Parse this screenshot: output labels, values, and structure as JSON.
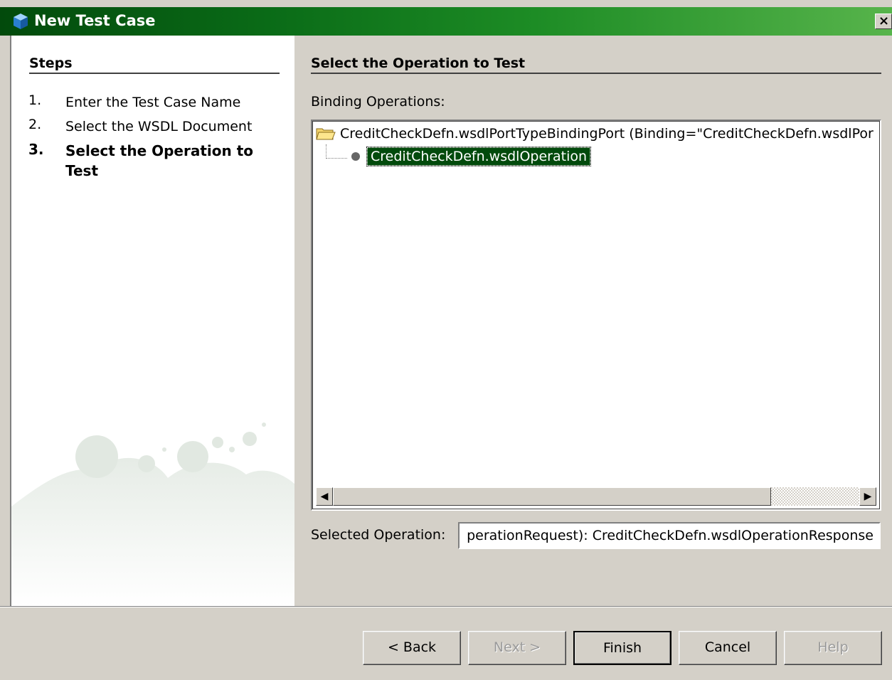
{
  "window": {
    "title": "New Test Case",
    "close_icon": "×",
    "title_gradient": [
      "#024a0c",
      "#57b44b"
    ]
  },
  "steps": {
    "heading": "Steps",
    "items": [
      {
        "num": "1.",
        "label": "Enter the Test Case Name"
      },
      {
        "num": "2.",
        "label": "Select the WSDL Document"
      },
      {
        "num": "3.",
        "label": "Select the Operation to Test"
      }
    ],
    "current_index": 3
  },
  "main": {
    "title": "Select the Operation to Test",
    "binding_label": "Binding Operations:",
    "tree": {
      "port": "CreditCheckDefn.wsdlPortTypeBindingPort (Binding=\"CreditCheckDefn.wsdlPor",
      "operation": "CreditCheckDefn.wsdlOperation",
      "selection_color": "#024a0c"
    },
    "selected_label": "Selected Operation:",
    "selected_value": "perationRequest): CreditCheckDefn.wsdlOperationResponse"
  },
  "buttons": {
    "back": "< Back",
    "next": "Next >",
    "finish": "Finish",
    "cancel": "Cancel",
    "help": "Help"
  }
}
